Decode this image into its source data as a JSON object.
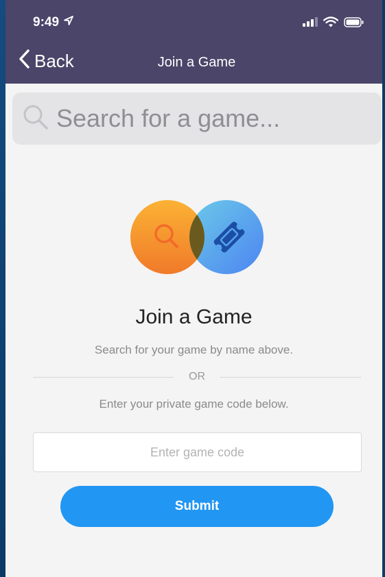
{
  "status_bar": {
    "time": "9:49"
  },
  "nav": {
    "back_label": "Back",
    "title": "Join a Game"
  },
  "search": {
    "placeholder": "Search for a game..."
  },
  "main": {
    "heading": "Join a Game",
    "search_hint": "Search for your game by name above.",
    "or_label": "OR",
    "code_hint": "Enter your private game code below.",
    "code_placeholder": "Enter game code",
    "submit_label": "Submit"
  },
  "colors": {
    "nav_background": "#4a4569",
    "submit_button": "#2196f3",
    "circle_orange": "#f5962a",
    "circle_blue": "#4f9af0"
  }
}
